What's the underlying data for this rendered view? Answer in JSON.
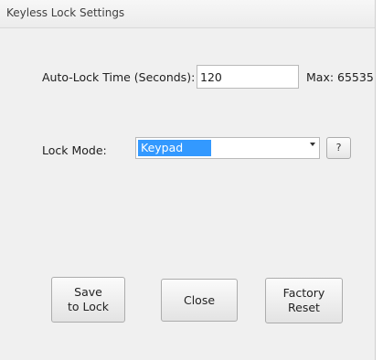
{
  "window": {
    "title": "Keyless Lock Settings"
  },
  "autolock": {
    "label": "Auto-Lock Time (Seconds):",
    "value": "120",
    "max_text": "Max: 65535"
  },
  "lockmode": {
    "label": "Lock Mode:",
    "selected": "Keypad",
    "help_label": "?"
  },
  "buttons": {
    "save": "Save\nto Lock",
    "close": "Close",
    "factory_reset": "Factory\nReset"
  },
  "colors": {
    "selection": "#3399ff",
    "window_bg": "#f0f0f0"
  }
}
